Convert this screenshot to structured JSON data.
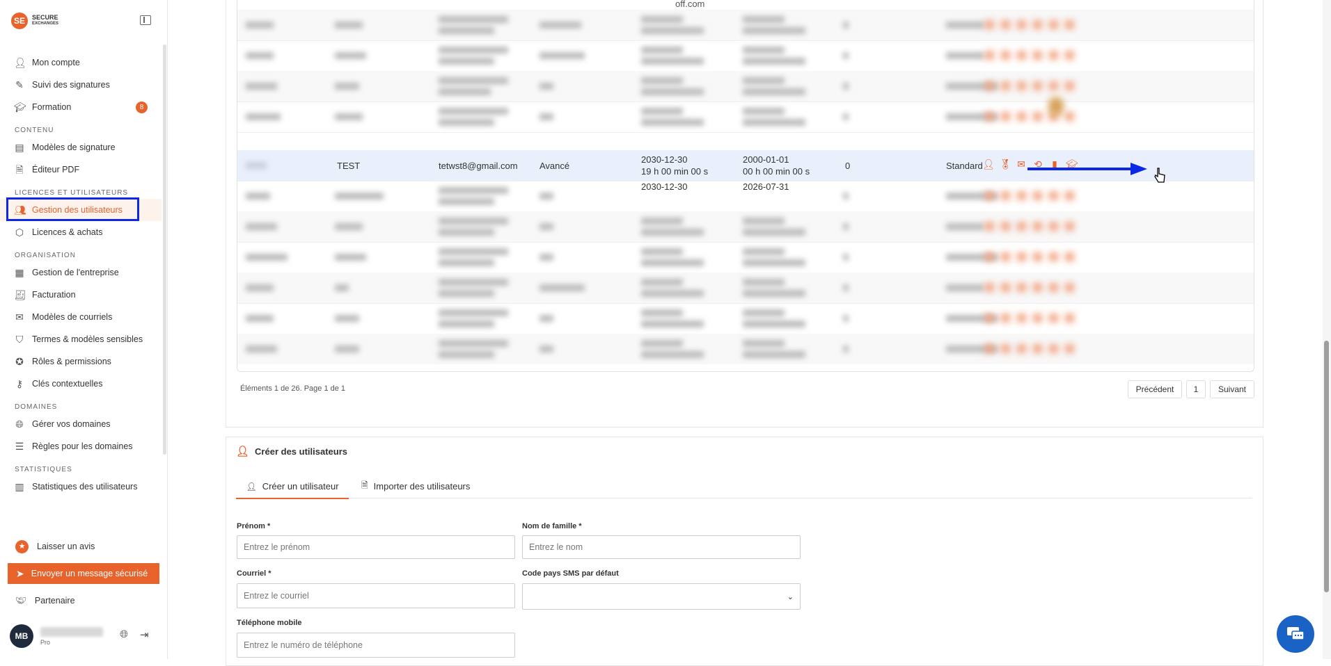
{
  "sidebar": {
    "logo_line1": "SECURE",
    "logo_line2": "EXCHANGES",
    "top_items": [
      {
        "label": "Mon compte",
        "icon": "user-icon"
      },
      {
        "label": "Suivi des signatures",
        "icon": "pen-icon"
      },
      {
        "label": "Formation",
        "icon": "graduation-cap-icon",
        "badge": "8"
      }
    ],
    "sections": [
      {
        "title": "CONTENU",
        "items": [
          {
            "label": "Modèles de signature",
            "icon": "template-icon"
          },
          {
            "label": "Éditeur PDF",
            "icon": "file-edit-icon"
          }
        ]
      },
      {
        "title": "LICENCES ET UTILISATEURS",
        "items": [
          {
            "label": "Gestion des utilisateurs",
            "icon": "users-icon",
            "active": true
          },
          {
            "label": "Licences & achats",
            "icon": "box-icon"
          }
        ]
      },
      {
        "title": "ORGANISATION",
        "items": [
          {
            "label": "Gestion de l'entreprise",
            "icon": "building-icon"
          },
          {
            "label": "Facturation",
            "icon": "receipt-icon"
          },
          {
            "label": "Modèles de courriels",
            "icon": "mail-icon"
          },
          {
            "label": "Termes & modèles sensibles",
            "icon": "shield-icon"
          },
          {
            "label": "Rôles & permissions",
            "icon": "badge-check-icon"
          },
          {
            "label": "Clés contextuelles",
            "icon": "key-icon"
          }
        ]
      },
      {
        "title": "DOMAINES",
        "items": [
          {
            "label": "Gérer vos domaines",
            "icon": "globe-icon"
          },
          {
            "label": "Règles pour les domaines",
            "icon": "sliders-icon"
          }
        ]
      },
      {
        "title": "STATISTIQUES",
        "items": [
          {
            "label": "Statistiques des utilisateurs",
            "icon": "bar-chart-icon"
          }
        ]
      }
    ],
    "review_label": "Laisser un avis",
    "send_label": "Envoyer un message sécurisé",
    "partner_label": "Partenaire",
    "user_initials": "MB",
    "user_plan": "Pro"
  },
  "table": {
    "top_fragment": "off.com",
    "highlighted_row": {
      "last_name": "TEST",
      "email": "tetwst8@gmail.com",
      "type": "Avancé",
      "date1_line1": "2030-12-30",
      "date1_line2": "19 h 00 min 00 s",
      "date2_line1": "2000-01-01",
      "date2_line2": "00 h 00 min 00 s",
      "count": "0",
      "plan": "Standard"
    },
    "next_row_partial_date1": "2030-12-30",
    "next_row_partial_date2": "2026-07-31",
    "pager_info": "Éléments 1 de 26. Page 1 de 1",
    "prev_label": "Précédent",
    "page_label": "1",
    "next_label": "Suivant"
  },
  "create": {
    "title": "Créer des utilisateurs",
    "tab_create": "Créer un utilisateur",
    "tab_import": "Importer des utilisateurs",
    "first_name_label": "Prénom *",
    "first_name_placeholder": "Entrez le prénom",
    "last_name_label": "Nom de famille *",
    "last_name_placeholder": "Entrez le nom",
    "email_label": "Courriel *",
    "email_placeholder": "Entrez le courriel",
    "sms_label": "Code pays SMS par défaut",
    "phone_label": "Téléphone mobile",
    "phone_placeholder": "Entrez le numéro de téléphone"
  },
  "colors": {
    "accent": "#e8632b",
    "highlight_box": "#0a28e6",
    "chat": "#1a62c4"
  }
}
